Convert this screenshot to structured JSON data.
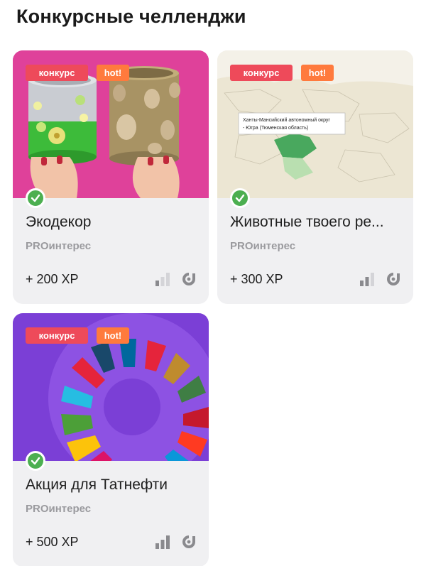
{
  "page": {
    "title": "Конкурсные челленджи"
  },
  "cards": [
    {
      "image": "eco-decor-cans-photo",
      "tags": {
        "contest": "конкурс",
        "hot": "hot!"
      },
      "completed": true,
      "title": "Экодекор",
      "author": "PROинтерес",
      "xp": "+ 200 XP",
      "difficulty": "1 of 3",
      "icons": {
        "status": "check-icon",
        "difficulty": "difficulty-bars-icon",
        "brand": "brand-logo-icon"
      }
    },
    {
      "image": "russia-map-screenshot",
      "map_label": "Ханты-Мансийский автономный округ - Югра (Тюменская область)",
      "tags": {
        "contest": "конкурс",
        "hot": "hot!"
      },
      "completed": true,
      "title": "Животные твоего ре...",
      "author": "PROинтерес",
      "xp": "+ 300 XP",
      "difficulty": "2 of 3",
      "icons": {
        "status": "check-icon",
        "difficulty": "difficulty-bars-icon",
        "brand": "brand-logo-icon"
      }
    },
    {
      "image": "sdg-goals-wheel",
      "tags": {
        "contest": "конкурс",
        "hot": "hot!"
      },
      "completed": true,
      "title": "Акция для Татнефти",
      "author": "PROинтерес",
      "xp": "+ 500 XP",
      "difficulty": "3 of 3",
      "icons": {
        "status": "check-icon",
        "difficulty": "difficulty-bars-icon",
        "brand": "brand-logo-icon"
      }
    }
  ],
  "colors": {
    "card_bg": "#f0f0f2",
    "tag_contest": "#ee4a5a",
    "tag_hot": "#ff7a3d",
    "check": "#4caf50",
    "bar_on": "#8a8a8e",
    "bar_off": "#d4d4d8"
  }
}
